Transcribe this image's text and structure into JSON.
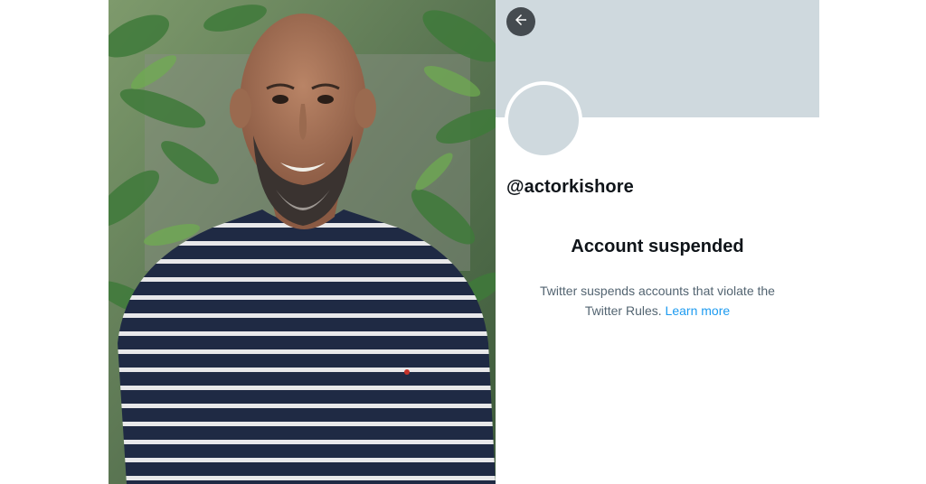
{
  "profile": {
    "handle": "@actorkishore"
  },
  "notice": {
    "title": "Account suspended",
    "body_line1": "Twitter suspends accounts that violate the",
    "body_line2": "Twitter Rules.",
    "link_text": "Learn more"
  },
  "icons": {
    "back": "arrow-left-icon"
  },
  "colors": {
    "banner": "#cfd9de",
    "avatar": "#cfd9de",
    "link": "#1d9bf0",
    "text_primary": "#0f1419",
    "text_secondary": "#536471"
  }
}
